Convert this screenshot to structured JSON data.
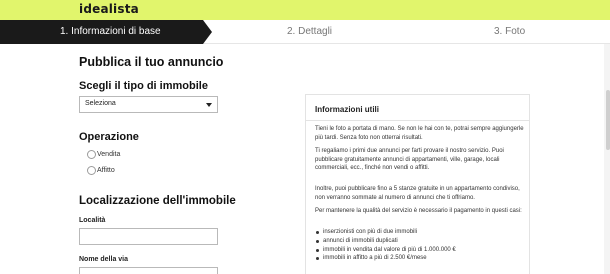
{
  "header": {
    "logo": "idealista"
  },
  "steps": [
    {
      "label": "1. Informazioni di base",
      "active": true
    },
    {
      "label": "2. Dettagli",
      "active": false
    },
    {
      "label": "3. Foto",
      "active": false
    }
  ],
  "form": {
    "page_title": "Pubblica il tuo annuncio",
    "tipo_title": "Scegli il tipo di immobile",
    "tipo_select_value": "Seleziona",
    "operazione_title": "Operazione",
    "operazione_options": [
      "Vendita",
      "Affitto"
    ],
    "localizzazione_title": "Localizzazione dell'immobile",
    "localita_label": "Località",
    "localita_value": "",
    "via_label": "Nome della via",
    "via_value": ""
  },
  "info": {
    "title": "Informazioni utili",
    "paragraphs": [
      "Tieni le foto a portata di mano. Se non le hai con te, potrai sempre aggiungerle più tardi. Senza foto non otterrai risultati.",
      "Ti regaliamo i primi due annunci per farti provare il nostro servizio. Puoi pubblicare gratuitamente annunci di appartamenti, ville, garage, locali commerciali, ecc., finché non vendi o affitti.",
      "Inoltre, puoi pubblicare fino a 5 stanze gratuite in un appartamento condiviso, non verranno sommate al numero di annunci che ti offriamo.",
      "Per mantenere la qualità del servizio è necessario il pagamento in questi casi:"
    ],
    "bullets": [
      "inserzionisti con più di due immobili",
      "annunci di immobili duplicati",
      "immobili in vendita dal valore di più di 1.000.000 €",
      "immobili in affitto a più di 2.500 €/mese"
    ]
  },
  "colors": {
    "brand_lime": "#e1f56c",
    "step_active_bg": "#1a1a1a"
  }
}
